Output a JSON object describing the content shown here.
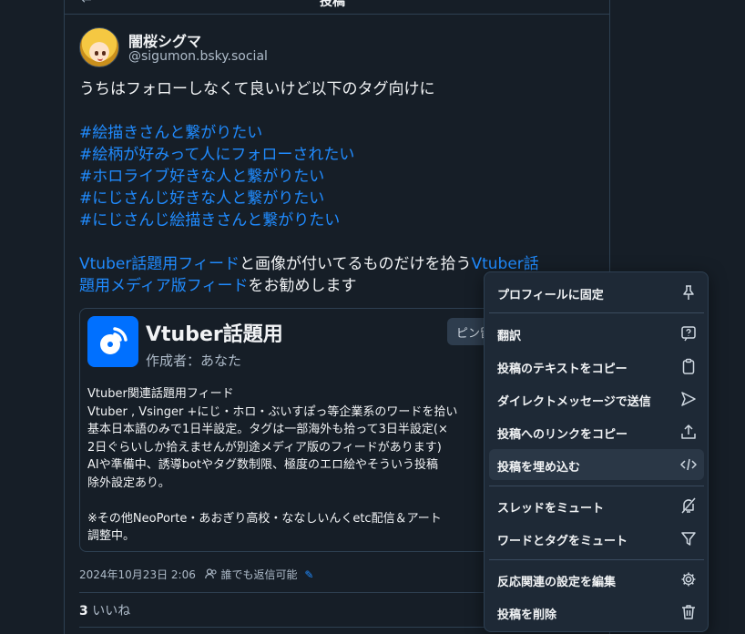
{
  "header": {
    "back": "←",
    "title": "投稿"
  },
  "author": {
    "display_name": "闇桜シグマ",
    "handle": "@sigumon.bsky.social"
  },
  "post": {
    "intro": "うちはフォローしなくて良いけど以下のタグ向けに",
    "tags": [
      "#絵描きさんと繋がりたい",
      "#絵柄が好みって人にフォローされたい",
      "#ホロライブ好きな人と繋がりたい",
      "#にじさんじ好きな人と繋がりたい",
      "#にじさんじ絵描きさんと繋がりたい"
    ],
    "outro_link1": "Vtuber話題用フィード",
    "outro_mid": "と画像が付いてるものだけを拾う",
    "outro_link2a": "Vtuber話",
    "outro_link2b": "題用メディア版フィード",
    "outro_end": "をお勧めします"
  },
  "feed_card": {
    "title": "Vtuber話題用",
    "author": "作成者：あなた",
    "pin_label": "ピン留",
    "description": [
      "Vtuber関連話題用フィード",
      "Vtuber , Vsinger +にじ・ホロ・ぶいすぽっ等企業系のワードを拾い",
      "基本日本語のみで1日半設定。タグは一部海外も拾って3日半設定(×",
      "2日ぐらいしか拾えませんが別途メディア版のフィードがあります)",
      "AIや準備中、誘導botやタグ数制限、極度のエロ絵やそういう投稿",
      "除外設定あり。",
      "",
      "※その他NeoPorte・あおぎり高校・ななしいんくetc配信＆アート",
      "調整中。"
    ]
  },
  "meta": {
    "timestamp": "2024年10月23日 2:06",
    "reply_setting": "誰でも返信可能"
  },
  "likes": {
    "count": "3",
    "label": " いいね"
  },
  "menu": {
    "items": [
      {
        "label": "プロフィールに固定",
        "icon": "pin-icon"
      },
      {
        "label": "翻訳",
        "icon": "translate-icon"
      },
      {
        "label": "投稿のテキストをコピー",
        "icon": "clipboard-icon"
      },
      {
        "label": "ダイレクトメッセージで送信",
        "icon": "send-icon"
      },
      {
        "label": "投稿へのリンクをコピー",
        "icon": "share-icon"
      },
      {
        "label": "投稿を埋め込む",
        "icon": "code-icon"
      },
      {
        "label": "スレッドをミュート",
        "icon": "mute-icon"
      },
      {
        "label": "ワードとタグをミュート",
        "icon": "filter-icon"
      },
      {
        "label": "反応関連の設定を編集",
        "icon": "gear-icon"
      },
      {
        "label": "投稿を削除",
        "icon": "trash-icon"
      }
    ]
  },
  "colors": {
    "background": "#161e27",
    "link": "#208bfe",
    "menu_bg": "#1e2936",
    "menu_highlight": "#2a3746"
  }
}
